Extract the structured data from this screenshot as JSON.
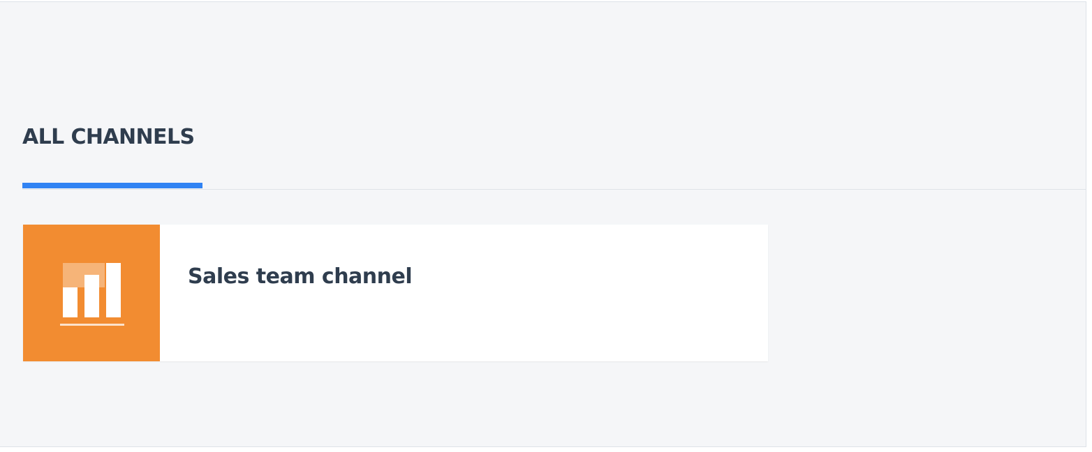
{
  "tabs": {
    "items": [
      {
        "label": "ALL CHANNELS",
        "active": true
      }
    ]
  },
  "channels": [
    {
      "name": "Sales team channel",
      "icon": "bar-chart-icon",
      "tile_color": "#f28c31"
    }
  ],
  "colors": {
    "background": "#f5f6f8",
    "text": "#2f3d4e",
    "accent": "#3183f3",
    "card": "#ffffff"
  }
}
